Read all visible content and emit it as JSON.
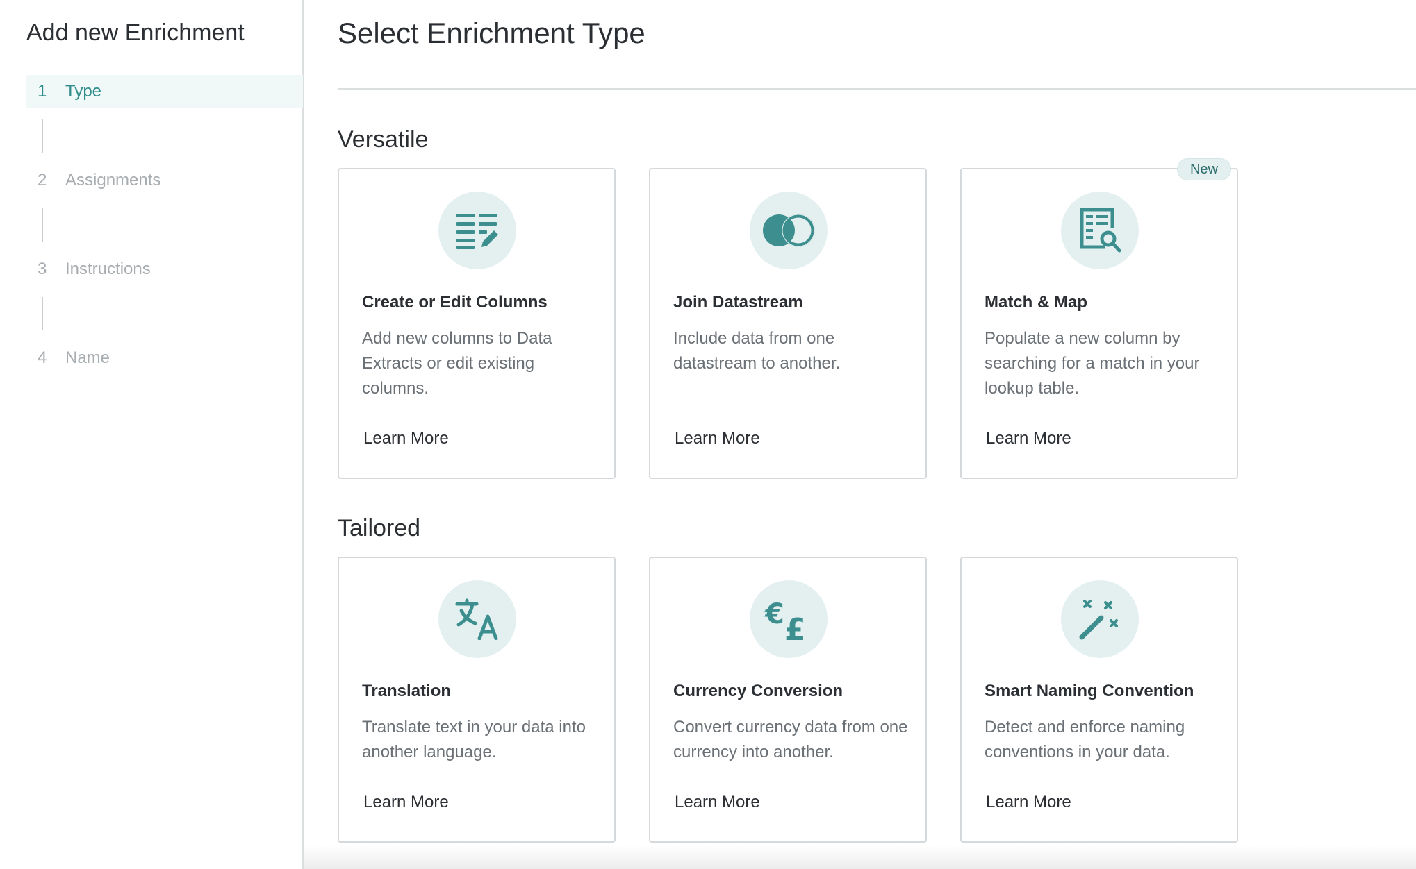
{
  "sidebar": {
    "title": "Add new Enrichment",
    "steps": [
      {
        "num": "1",
        "label": "Type",
        "active": true
      },
      {
        "num": "2",
        "label": "Assignments",
        "active": false
      },
      {
        "num": "3",
        "label": "Instructions",
        "active": false
      },
      {
        "num": "4",
        "label": "Name",
        "active": false
      }
    ]
  },
  "main": {
    "title": "Select Enrichment Type",
    "sections": [
      {
        "title": "Versatile",
        "cards": [
          {
            "icon": "edit-columns-icon",
            "title": "Create or Edit Columns",
            "description": "Add new columns to Data Extracts or edit existing columns.",
            "link": "Learn More"
          },
          {
            "icon": "join-circles-icon",
            "title": "Join Datastream",
            "description": "Include data from one datastream to another.",
            "link": "Learn More"
          },
          {
            "icon": "document-search-icon",
            "title": "Match & Map",
            "description": "Populate a new column by searching for a match in your lookup table.",
            "link": "Learn More",
            "badge": "New"
          }
        ]
      },
      {
        "title": "Tailored",
        "cards": [
          {
            "icon": "translate-icon",
            "title": "Translation",
            "description": "Translate text in your data into another language.",
            "link": "Learn More"
          },
          {
            "icon": "currency-icon",
            "title": "Currency Conversion",
            "description": "Convert currency data from one currency into another.",
            "link": "Learn More"
          },
          {
            "icon": "magic-wand-icon",
            "title": "Smart Naming Convention",
            "description": "Detect and enforce naming conventions in your data.",
            "link": "Learn More"
          }
        ]
      }
    ]
  },
  "colors": {
    "accent": "#2f8c8c",
    "icon_bg": "#e4f0f0",
    "icon_fg": "#3d8f8f"
  }
}
